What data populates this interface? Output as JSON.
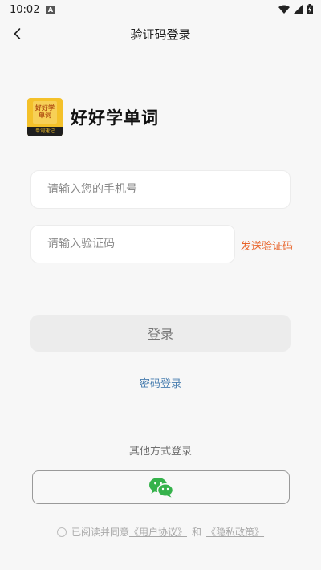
{
  "status_bar": {
    "time": "10:02",
    "notification_glyph": "A"
  },
  "nav": {
    "title": "验证码登录"
  },
  "brand": {
    "name": "好好学单词",
    "logo_book_text": "好好学\n单词",
    "logo_band_text": "单词速记",
    "color": "#f4c12a"
  },
  "form": {
    "phone_placeholder": "请输入您的手机号",
    "phone_value": "",
    "code_placeholder": "请输入验证码",
    "code_value": "",
    "send_code_label": "发送验证码"
  },
  "actions": {
    "login_label": "登录",
    "password_login_label": "密码登录"
  },
  "other_login": {
    "divider_label": "其他方式登录",
    "wechat_icon": "wechat-icon",
    "wechat_color": "#35b24b"
  },
  "agreement": {
    "prefix": "已阅读并同意",
    "user_agreement": "《用户协议》",
    "and": "和",
    "privacy_policy": "《隐私政策》",
    "checked": false
  },
  "colors": {
    "accent": "#e8642a",
    "link": "#4a7fb0"
  }
}
